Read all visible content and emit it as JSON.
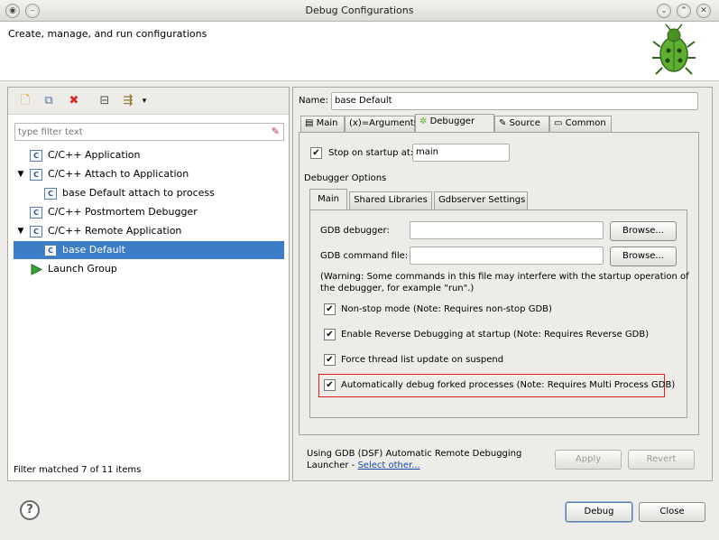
{
  "window": {
    "title": "Debug Configurations",
    "buttons": [
      "minimize-icon",
      "maximize-icon",
      "close-icon"
    ]
  },
  "banner": {
    "message": "Create, manage, and run configurations",
    "logo": "bug-icon"
  },
  "left": {
    "toolbar": [
      "new-config-icon",
      "duplicate-icon",
      "delete-icon",
      "collapse-all-icon",
      "filter-icon"
    ],
    "filter_placeholder": "type filter text",
    "tree": [
      {
        "label": "C/C++ Application",
        "level": 0,
        "expanded": false
      },
      {
        "label": "C/C++ Attach to Application",
        "level": 0,
        "expanded": true
      },
      {
        "label": "base Default attach to process",
        "level": 1
      },
      {
        "label": "C/C++ Postmortem Debugger",
        "level": 0
      },
      {
        "label": "C/C++ Remote Application",
        "level": 0,
        "expanded": true
      },
      {
        "label": "base Default",
        "level": 1,
        "selected": true
      },
      {
        "label": "Launch Group",
        "level": 0
      }
    ],
    "status": "Filter matched 7 of 11 items"
  },
  "right": {
    "name_label": "Name:",
    "name_value": "base Default",
    "tabs": [
      "Main",
      "Arguments",
      "Debugger",
      "Source",
      "Common"
    ],
    "active_tab": "Debugger",
    "stop_on_startup_label": "Stop on startup at:",
    "stop_on_startup_value": "main",
    "debugger_options_label": "Debugger Options",
    "subtabs": [
      "Main",
      "Shared Libraries",
      "Gdbserver Settings"
    ],
    "gdb_debugger_label": "GDB debugger:",
    "gdb_debugger_value": "",
    "gdb_command_file_label": "GDB command file:",
    "gdb_command_file_value": "",
    "browse_label": "Browse...",
    "warning_line1": "(Warning: Some commands in this file may interfere with the startup operation of",
    "warning_line2": "the debugger, for example \"run\".)",
    "checkboxes": [
      {
        "label": "Non-stop mode (Note: Requires non-stop GDB)",
        "checked": true
      },
      {
        "label": "Enable Reverse Debugging at startup (Note: Requires Reverse GDB)",
        "checked": true
      },
      {
        "label": "Force thread list update on suspend",
        "checked": true
      },
      {
        "label": "Automatically debug forked processes (Note: Requires Multi Process GDB)",
        "checked": true
      }
    ],
    "launcher_line1": "Using GDB (DSF) Automatic Remote Debugging",
    "launcher_line2": "Launcher - ",
    "select_other": "Select other...",
    "apply_label": "Apply",
    "revert_label": "Revert"
  },
  "footer": {
    "help": "?",
    "debug_label": "Debug",
    "close_label": "Close"
  },
  "colors": {
    "selection": "#3d7cc7",
    "highlight_border": "#e02020"
  }
}
